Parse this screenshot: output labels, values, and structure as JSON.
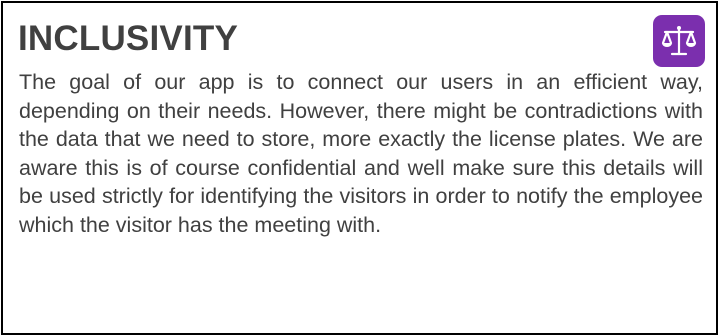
{
  "card": {
    "title": "INCLUSIVITY",
    "icon": "scales-of-justice-icon",
    "accent_color": "#7b2fae",
    "body": "The goal of our app is to connect our users in an efficient way, depending on their needs. However, there might be contradictions with the data that we need to store, more exactly the license plates. We are aware this is of course confidential and well make sure this details will be used strictly for identifying the visitors in order to notify the employee which the visitor has the meeting with."
  }
}
